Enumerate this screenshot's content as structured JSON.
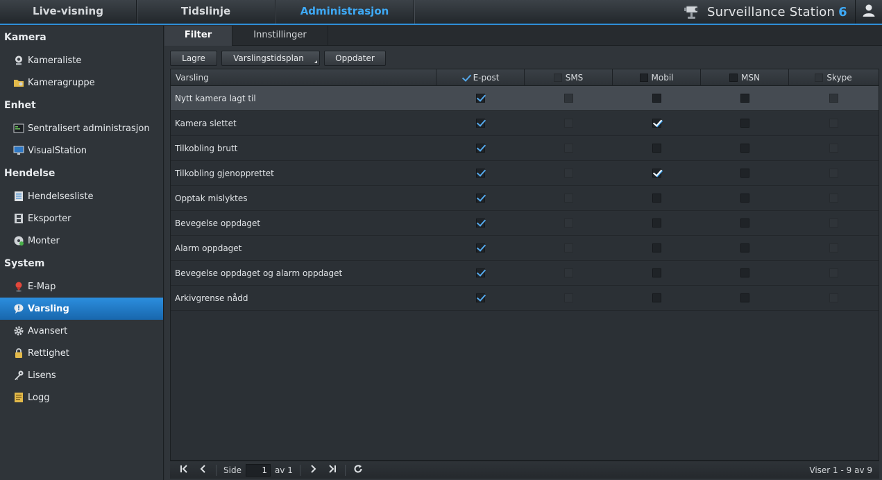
{
  "topnav": {
    "tabs": [
      "Live-visning",
      "Tidslinje",
      "Administrasjon"
    ],
    "active_tab": "Administrasjon",
    "brand": "Surveillance Station",
    "brand_version": "6",
    "accent": "#3ea9f5"
  },
  "sidebar": {
    "sections": [
      {
        "title": "Kamera",
        "items": [
          {
            "label": "Kameraliste",
            "icon": "camera-icon"
          },
          {
            "label": "Kameragruppe",
            "icon": "folder-icon"
          }
        ]
      },
      {
        "title": "Enhet",
        "items": [
          {
            "label": "Sentralisert administrasjon",
            "icon": "terminal-icon"
          },
          {
            "label": "VisualStation",
            "icon": "monitor-icon"
          }
        ]
      },
      {
        "title": "Hendelse",
        "items": [
          {
            "label": "Hendelsesliste",
            "icon": "list-icon"
          },
          {
            "label": "Eksporter",
            "icon": "film-icon"
          },
          {
            "label": "Monter",
            "icon": "disc-icon"
          }
        ]
      },
      {
        "title": "System",
        "items": [
          {
            "label": "E-Map",
            "icon": "map-pin-icon"
          },
          {
            "label": "Varsling",
            "icon": "alert-icon",
            "active": true
          },
          {
            "label": "Avansert",
            "icon": "gear-icon"
          },
          {
            "label": "Rettighet",
            "icon": "lock-icon"
          },
          {
            "label": "Lisens",
            "icon": "key-icon"
          },
          {
            "label": "Logg",
            "icon": "log-icon"
          }
        ]
      }
    ]
  },
  "content": {
    "tabs": [
      "Filter",
      "Innstillinger"
    ],
    "active_tab": "Filter",
    "toolbar": {
      "save": "Lagre",
      "schedule": "Varslingstidsplan",
      "refresh": "Oppdater"
    },
    "grid": {
      "columns": [
        {
          "label": "Varsling"
        },
        {
          "label": "E-post",
          "checked": true,
          "enabled": true
        },
        {
          "label": "SMS",
          "checked": false,
          "enabled": false
        },
        {
          "label": "Mobil",
          "checked": false,
          "enabled": true
        },
        {
          "label": "MSN",
          "checked": false,
          "enabled": true
        },
        {
          "label": "Skype",
          "checked": false,
          "enabled": false
        }
      ],
      "rows": [
        {
          "name": "Nytt kamera lagt til",
          "email": true,
          "sms": false,
          "mobile": false,
          "msn": false,
          "skype": false,
          "selected": true
        },
        {
          "name": "Kamera slettet",
          "email": true,
          "sms": false,
          "mobile": true,
          "msn": false,
          "skype": false
        },
        {
          "name": "Tilkobling brutt",
          "email": true,
          "sms": false,
          "mobile": false,
          "msn": false,
          "skype": false
        },
        {
          "name": "Tilkobling gjenopprettet",
          "email": true,
          "sms": false,
          "mobile": true,
          "msn": false,
          "skype": false
        },
        {
          "name": "Opptak mislyktes",
          "email": true,
          "sms": false,
          "mobile": false,
          "msn": false,
          "skype": false
        },
        {
          "name": "Bevegelse oppdaget",
          "email": true,
          "sms": false,
          "mobile": false,
          "msn": false,
          "skype": false
        },
        {
          "name": "Alarm oppdaget",
          "email": true,
          "sms": false,
          "mobile": false,
          "msn": false,
          "skype": false
        },
        {
          "name": "Bevegelse oppdaget og alarm oppdaget",
          "email": true,
          "sms": false,
          "mobile": false,
          "msn": false,
          "skype": false
        },
        {
          "name": "Arkivgrense nådd",
          "email": true,
          "sms": false,
          "mobile": false,
          "msn": false,
          "skype": false
        }
      ]
    },
    "pager": {
      "page_label": "Side",
      "page_value": "1",
      "of_label": "av 1",
      "info": "Viser 1 - 9 av 9"
    }
  }
}
